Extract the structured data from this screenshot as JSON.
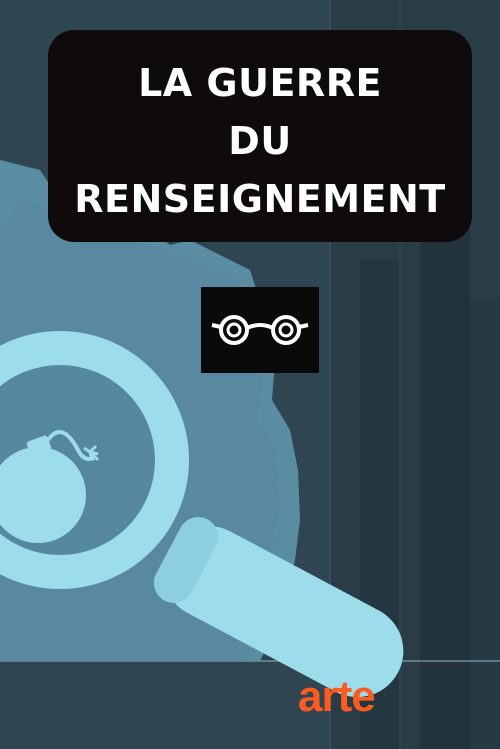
{
  "title": {
    "lines": [
      "LA GUERRE",
      "DU",
      "RENSEIGNEMENT"
    ]
  },
  "badge": {
    "icon": "glasses-icon"
  },
  "brand": {
    "text": "arte",
    "color": "#ff5a1f"
  },
  "illustration": {
    "icons": [
      "map-shape",
      "magnifying-glass-icon",
      "bomb-icon"
    ],
    "colors": {
      "background": "#2f4652",
      "map": "#5b8da2",
      "lens": "#9ddcea"
    }
  }
}
